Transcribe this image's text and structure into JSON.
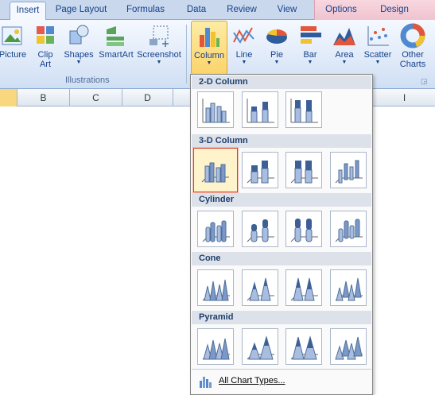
{
  "tabs": [
    {
      "label": "Insert",
      "active": true
    },
    {
      "label": "Page Layout"
    },
    {
      "label": "Formulas"
    },
    {
      "label": "Data"
    },
    {
      "label": "Review"
    },
    {
      "label": "View"
    },
    {
      "label": "Options"
    },
    {
      "label": "Design"
    }
  ],
  "ribbon": {
    "picture": "Picture",
    "clipart_line1": "Clip",
    "clipart_line2": "Art",
    "shapes": "Shapes",
    "smartart": "SmartArt",
    "screenshot": "Screenshot",
    "illustrations_group": "Illustrations",
    "column": "Column",
    "line": "Line",
    "pie": "Pie",
    "bar": "Bar",
    "area": "Area",
    "scatter": "Scatter",
    "other_line1": "Other",
    "other_line2": "Charts"
  },
  "columns": [
    "",
    "B",
    "C",
    "D",
    "",
    "I"
  ],
  "gallery": {
    "sections": [
      "2-D Column",
      "3-D Column",
      "Cylinder",
      "Cone",
      "Pyramid"
    ],
    "footer": "All Chart Types..."
  },
  "colors": {
    "accent": "#15428b",
    "highlight": "#d7402c"
  }
}
